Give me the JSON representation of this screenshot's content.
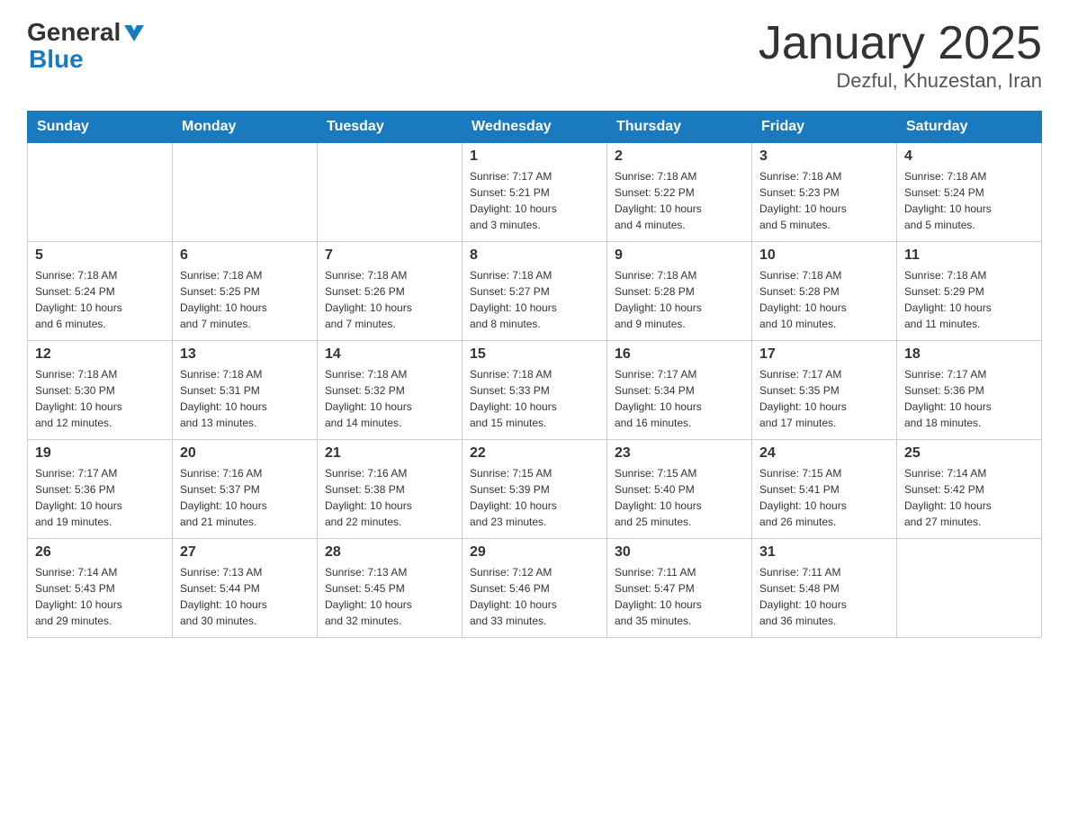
{
  "header": {
    "logo_general": "General",
    "logo_blue": "Blue",
    "month_title": "January 2025",
    "location": "Dezful, Khuzestan, Iran"
  },
  "weekdays": [
    "Sunday",
    "Monday",
    "Tuesday",
    "Wednesday",
    "Thursday",
    "Friday",
    "Saturday"
  ],
  "weeks": [
    [
      {
        "day": "",
        "info": ""
      },
      {
        "day": "",
        "info": ""
      },
      {
        "day": "",
        "info": ""
      },
      {
        "day": "1",
        "info": "Sunrise: 7:17 AM\nSunset: 5:21 PM\nDaylight: 10 hours\nand 3 minutes."
      },
      {
        "day": "2",
        "info": "Sunrise: 7:18 AM\nSunset: 5:22 PM\nDaylight: 10 hours\nand 4 minutes."
      },
      {
        "day": "3",
        "info": "Sunrise: 7:18 AM\nSunset: 5:23 PM\nDaylight: 10 hours\nand 5 minutes."
      },
      {
        "day": "4",
        "info": "Sunrise: 7:18 AM\nSunset: 5:24 PM\nDaylight: 10 hours\nand 5 minutes."
      }
    ],
    [
      {
        "day": "5",
        "info": "Sunrise: 7:18 AM\nSunset: 5:24 PM\nDaylight: 10 hours\nand 6 minutes."
      },
      {
        "day": "6",
        "info": "Sunrise: 7:18 AM\nSunset: 5:25 PM\nDaylight: 10 hours\nand 7 minutes."
      },
      {
        "day": "7",
        "info": "Sunrise: 7:18 AM\nSunset: 5:26 PM\nDaylight: 10 hours\nand 7 minutes."
      },
      {
        "day": "8",
        "info": "Sunrise: 7:18 AM\nSunset: 5:27 PM\nDaylight: 10 hours\nand 8 minutes."
      },
      {
        "day": "9",
        "info": "Sunrise: 7:18 AM\nSunset: 5:28 PM\nDaylight: 10 hours\nand 9 minutes."
      },
      {
        "day": "10",
        "info": "Sunrise: 7:18 AM\nSunset: 5:28 PM\nDaylight: 10 hours\nand 10 minutes."
      },
      {
        "day": "11",
        "info": "Sunrise: 7:18 AM\nSunset: 5:29 PM\nDaylight: 10 hours\nand 11 minutes."
      }
    ],
    [
      {
        "day": "12",
        "info": "Sunrise: 7:18 AM\nSunset: 5:30 PM\nDaylight: 10 hours\nand 12 minutes."
      },
      {
        "day": "13",
        "info": "Sunrise: 7:18 AM\nSunset: 5:31 PM\nDaylight: 10 hours\nand 13 minutes."
      },
      {
        "day": "14",
        "info": "Sunrise: 7:18 AM\nSunset: 5:32 PM\nDaylight: 10 hours\nand 14 minutes."
      },
      {
        "day": "15",
        "info": "Sunrise: 7:18 AM\nSunset: 5:33 PM\nDaylight: 10 hours\nand 15 minutes."
      },
      {
        "day": "16",
        "info": "Sunrise: 7:17 AM\nSunset: 5:34 PM\nDaylight: 10 hours\nand 16 minutes."
      },
      {
        "day": "17",
        "info": "Sunrise: 7:17 AM\nSunset: 5:35 PM\nDaylight: 10 hours\nand 17 minutes."
      },
      {
        "day": "18",
        "info": "Sunrise: 7:17 AM\nSunset: 5:36 PM\nDaylight: 10 hours\nand 18 minutes."
      }
    ],
    [
      {
        "day": "19",
        "info": "Sunrise: 7:17 AM\nSunset: 5:36 PM\nDaylight: 10 hours\nand 19 minutes."
      },
      {
        "day": "20",
        "info": "Sunrise: 7:16 AM\nSunset: 5:37 PM\nDaylight: 10 hours\nand 21 minutes."
      },
      {
        "day": "21",
        "info": "Sunrise: 7:16 AM\nSunset: 5:38 PM\nDaylight: 10 hours\nand 22 minutes."
      },
      {
        "day": "22",
        "info": "Sunrise: 7:15 AM\nSunset: 5:39 PM\nDaylight: 10 hours\nand 23 minutes."
      },
      {
        "day": "23",
        "info": "Sunrise: 7:15 AM\nSunset: 5:40 PM\nDaylight: 10 hours\nand 25 minutes."
      },
      {
        "day": "24",
        "info": "Sunrise: 7:15 AM\nSunset: 5:41 PM\nDaylight: 10 hours\nand 26 minutes."
      },
      {
        "day": "25",
        "info": "Sunrise: 7:14 AM\nSunset: 5:42 PM\nDaylight: 10 hours\nand 27 minutes."
      }
    ],
    [
      {
        "day": "26",
        "info": "Sunrise: 7:14 AM\nSunset: 5:43 PM\nDaylight: 10 hours\nand 29 minutes."
      },
      {
        "day": "27",
        "info": "Sunrise: 7:13 AM\nSunset: 5:44 PM\nDaylight: 10 hours\nand 30 minutes."
      },
      {
        "day": "28",
        "info": "Sunrise: 7:13 AM\nSunset: 5:45 PM\nDaylight: 10 hours\nand 32 minutes."
      },
      {
        "day": "29",
        "info": "Sunrise: 7:12 AM\nSunset: 5:46 PM\nDaylight: 10 hours\nand 33 minutes."
      },
      {
        "day": "30",
        "info": "Sunrise: 7:11 AM\nSunset: 5:47 PM\nDaylight: 10 hours\nand 35 minutes."
      },
      {
        "day": "31",
        "info": "Sunrise: 7:11 AM\nSunset: 5:48 PM\nDaylight: 10 hours\nand 36 minutes."
      },
      {
        "day": "",
        "info": ""
      }
    ]
  ]
}
